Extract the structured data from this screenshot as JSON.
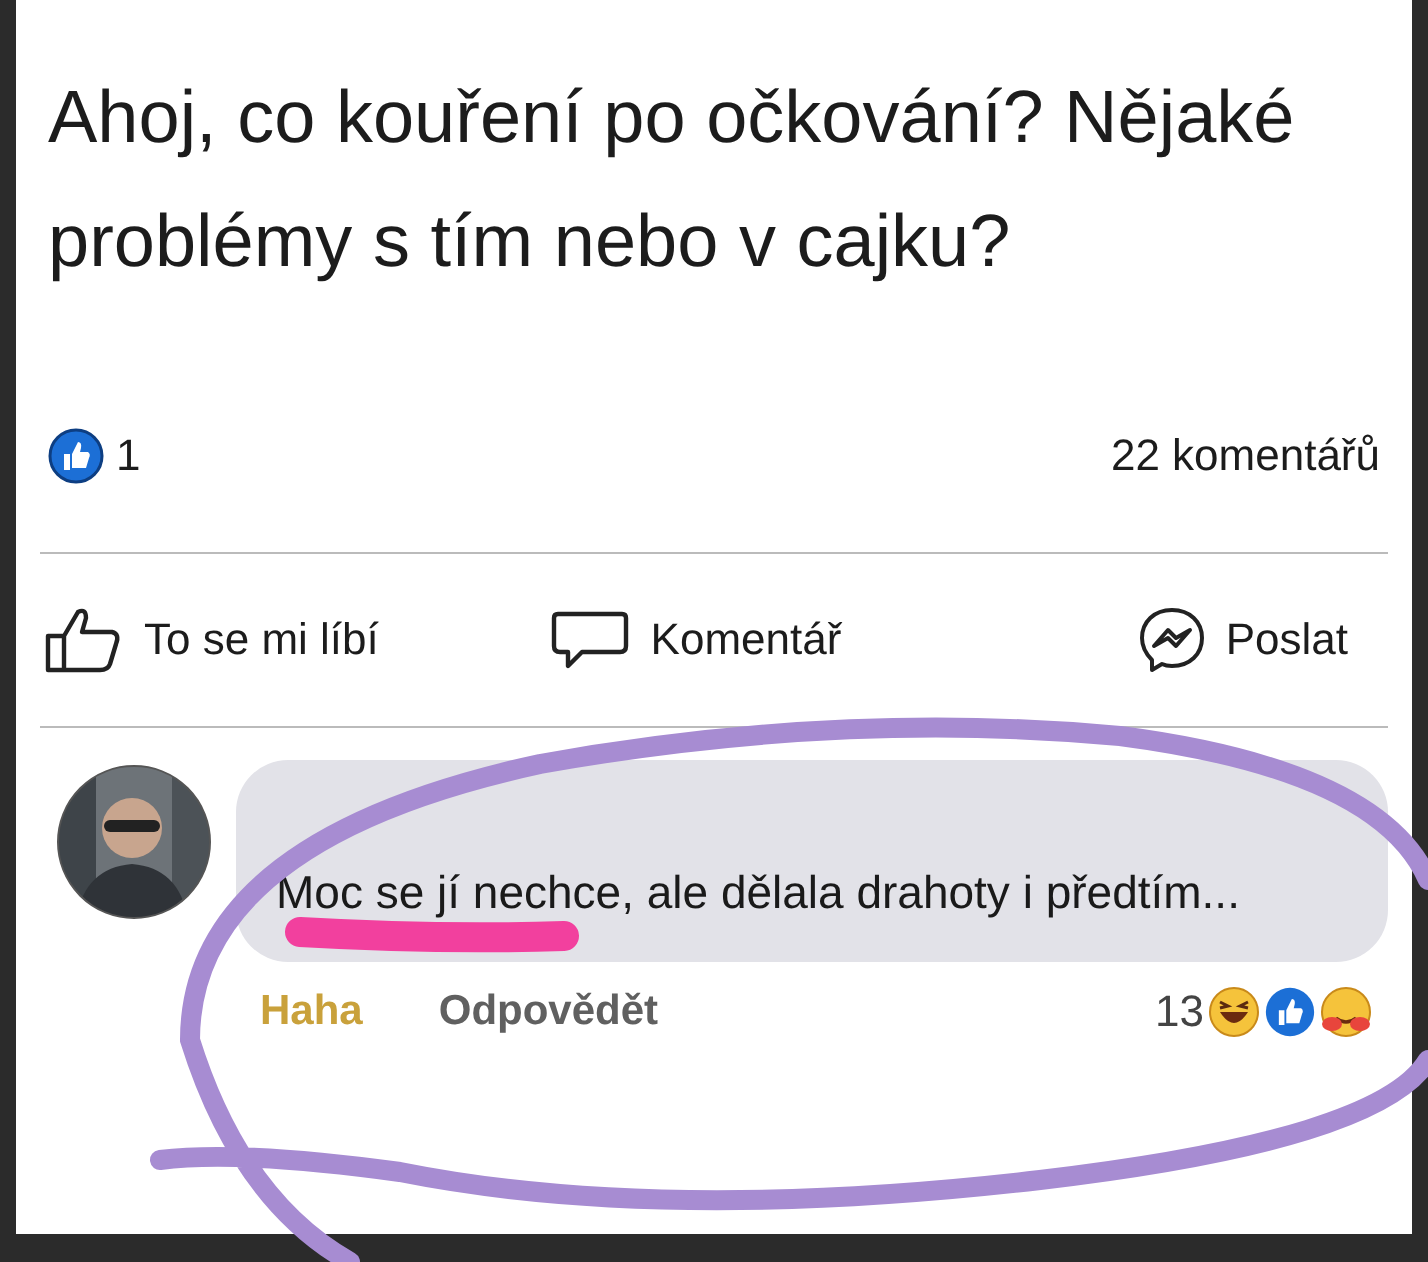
{
  "post": {
    "text": "Ahoj, co kouření po očkování? Nějaké problémy s tím nebo v cajku?",
    "like_count": "1",
    "comment_count": "22 komentářů"
  },
  "actions": [
    {
      "kind": "like",
      "label": "To se mi líbí"
    },
    {
      "kind": "comment",
      "label": "Komentář"
    },
    {
      "kind": "share",
      "label": "Poslat"
    }
  ],
  "comment": {
    "text": "Moc se jí nechce, ale dělala drahoty i předtím...",
    "reaction": "Haha",
    "reply": "Odpovědět",
    "reaction_count": "13"
  },
  "annotations": [
    {
      "kind": "scribble",
      "color": "#f2409e"
    },
    {
      "kind": "circle",
      "color": "#a78cd2"
    }
  ]
}
